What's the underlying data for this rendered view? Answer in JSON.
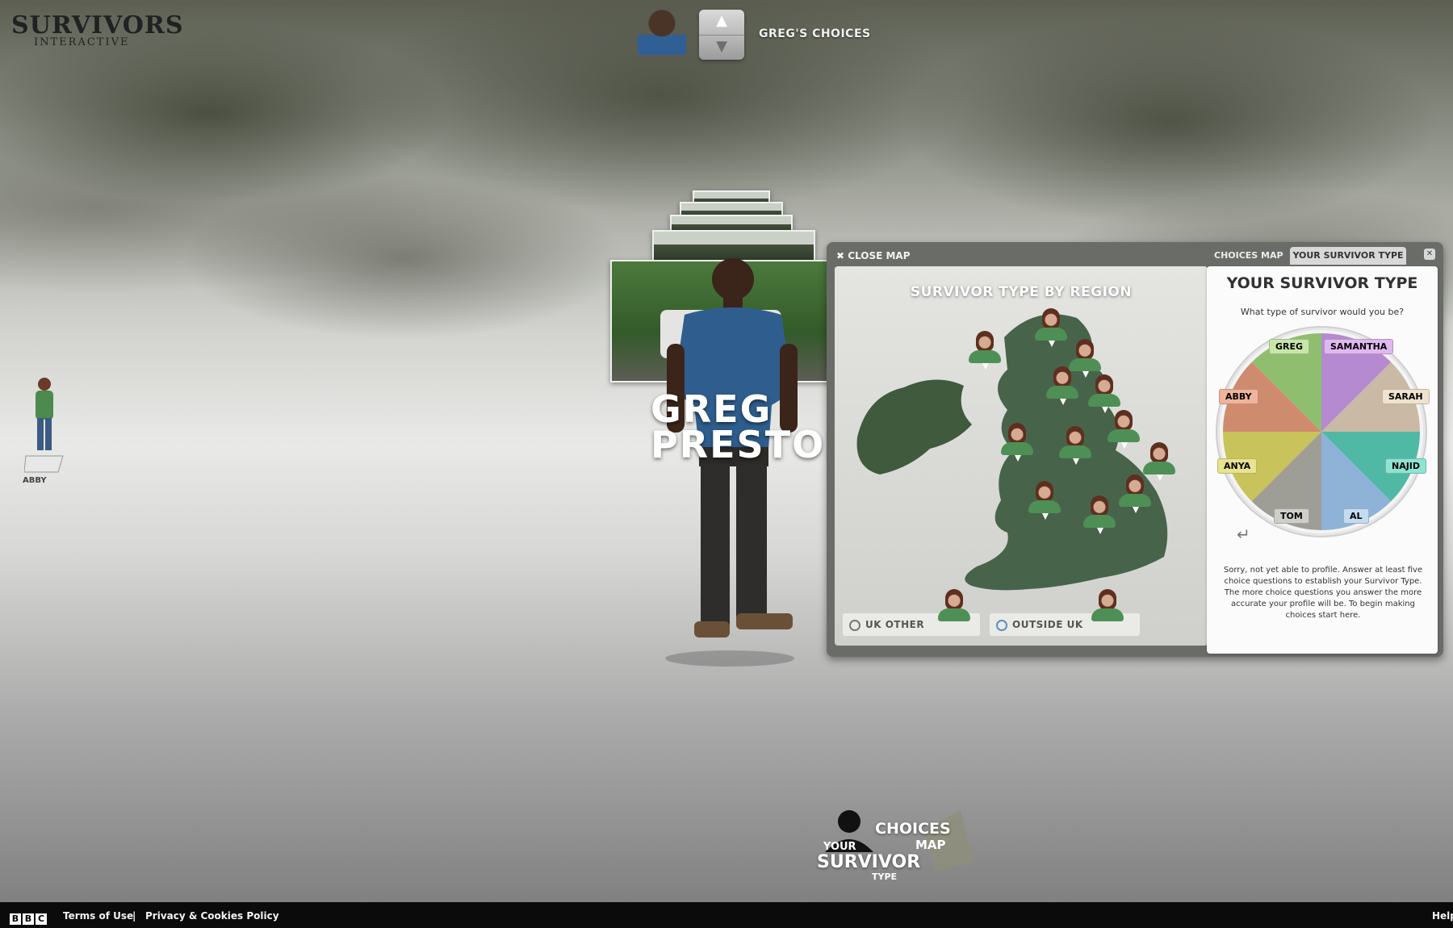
{
  "logo": {
    "title": "SURVIVORS",
    "subtitle": "INTERACTIVE"
  },
  "top_selector": {
    "title": "GREG'S CHOICES",
    "up_icon": "chevron-up-icon",
    "down_icon": "chevron-down-icon"
  },
  "side_character": {
    "label": "ABBY"
  },
  "hero": {
    "name_line1": "GREG",
    "name_line2": "PRESTON"
  },
  "map_panel": {
    "close_label": "CLOSE MAP",
    "tabs": [
      {
        "label": "CHOICES MAP"
      },
      {
        "label": "YOUR SURVIVOR TYPE"
      }
    ],
    "close_icon": "x-icon",
    "map_title": "SURVIVOR TYPE BY REGION",
    "legend": [
      {
        "label": "UK OTHER"
      },
      {
        "label": "OUTSIDE UK"
      }
    ]
  },
  "survivor_type": {
    "title": "YOUR SURVIVOR TYPE",
    "question": "What type of survivor would you be?",
    "types": [
      "GREG",
      "SAMANTHA",
      "ABBY",
      "SARAH",
      "ANYA",
      "NAJID",
      "TOM",
      "AL"
    ],
    "message": "Sorry, not yet able to profile. Answer at least five choice questions to establish your Survivor Type. The more choice questions you answer the more accurate your profile will be. To begin making choices start here."
  },
  "colors": {
    "greg": "#8fbf6e",
    "samantha": "#b58ad0",
    "abby": "#cf8b6e",
    "sarah": "#c9b9a5",
    "anya": "#c8c35a",
    "najid": "#4fb9a6",
    "tom": "#9e9e96",
    "al": "#8fb3d6"
  },
  "bottom_nav": {
    "your": "YOUR",
    "survivor": "SURVIVOR",
    "type": "TYPE",
    "choices": "CHOICES",
    "map": "MAP"
  },
  "footer": {
    "terms": "Terms of Use",
    "separator": "|",
    "privacy": "Privacy & Cookies Policy",
    "help": "Help"
  }
}
